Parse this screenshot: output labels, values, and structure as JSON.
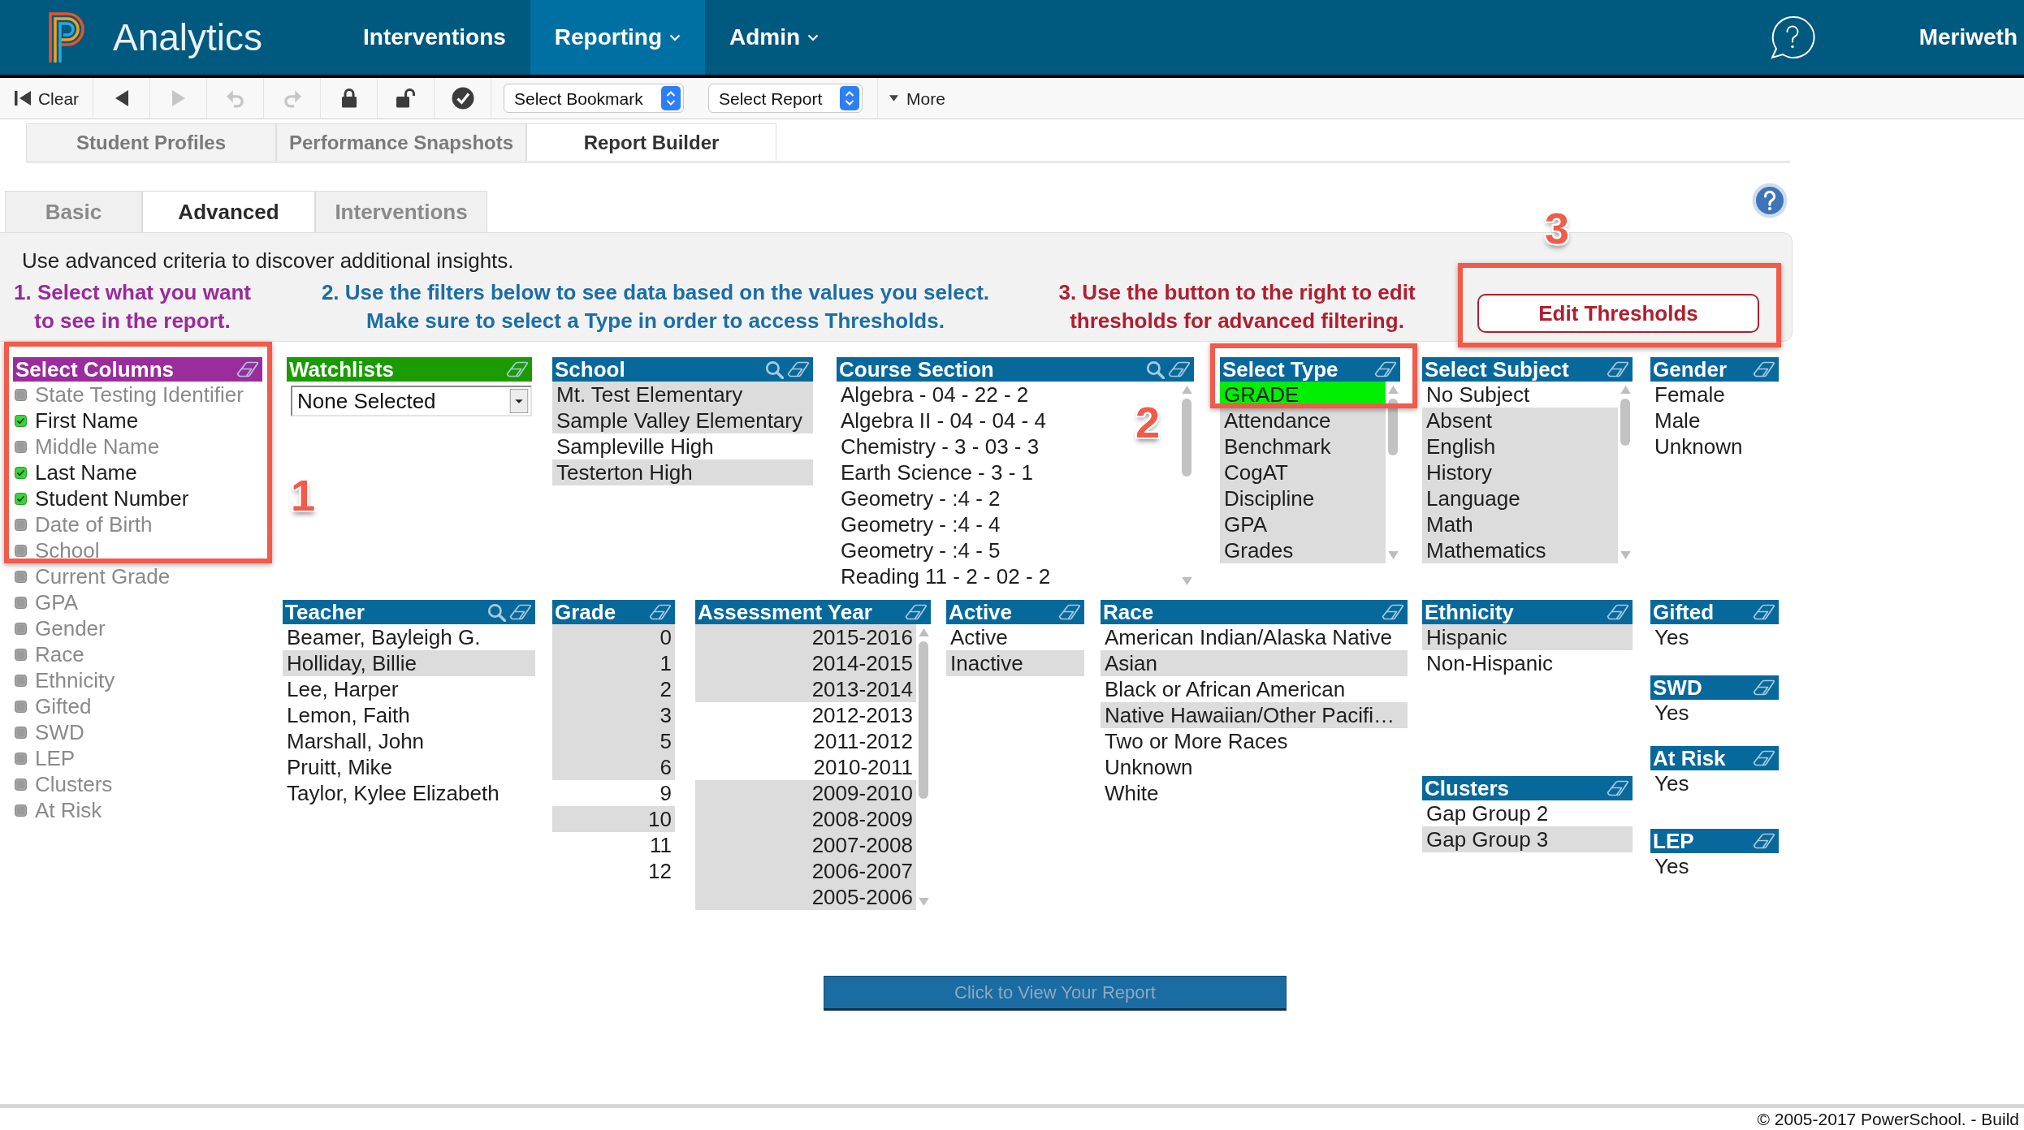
{
  "nav": {
    "brand": "Analytics",
    "items": [
      {
        "label": "Interventions",
        "selected": false,
        "menu": false
      },
      {
        "label": "Reporting",
        "selected": true,
        "menu": true
      },
      {
        "label": "Admin",
        "selected": false,
        "menu": true
      }
    ],
    "user": "Meriweth"
  },
  "toolbar": {
    "buttons": [
      {
        "kind": "first",
        "label": "Clear",
        "disabled": false
      },
      {
        "kind": "back",
        "disabled": false
      },
      {
        "kind": "forward",
        "disabled": true
      },
      {
        "kind": "undo",
        "disabled": true
      },
      {
        "kind": "redo",
        "disabled": true
      },
      {
        "kind": "lock",
        "disabled": false
      },
      {
        "kind": "unlock",
        "disabled": false
      },
      {
        "kind": "check",
        "disabled": false
      }
    ],
    "selects": [
      {
        "value": "Select Bookmark"
      },
      {
        "value": "Select Report"
      }
    ],
    "more": "More"
  },
  "page_tabs": [
    {
      "label": "Student Profiles",
      "selected": false
    },
    {
      "label": "Performance Snapshots",
      "selected": false
    },
    {
      "label": "Report Builder",
      "selected": true
    }
  ],
  "mode_tabs": [
    {
      "label": "Basic",
      "selected": false
    },
    {
      "label": "Advanced",
      "selected": true
    },
    {
      "label": "Interventions",
      "selected": false
    }
  ],
  "criteria_panel": {
    "intro": "Use advanced criteria to discover additional insights.",
    "steps": [
      {
        "lines": [
          "1. Select what you want",
          "to see in the report."
        ],
        "color": "#9b2a9b"
      },
      {
        "lines": [
          "2. Use the filters below to see data based on the values you select.",
          "Make sure to select a Type in order to access Thresholds."
        ],
        "color": "#1c6ea4"
      },
      {
        "lines": [
          "3. Use the button to the right to edit",
          "thresholds for advanced filtering."
        ],
        "color": "#b01e2f"
      }
    ],
    "edit_button": "Edit Thresholds"
  },
  "column_picker": {
    "title": "Select Columns",
    "color": "#9b2c9c",
    "items": [
      {
        "label": "State Testing Identifier",
        "checked": false
      },
      {
        "label": "First Name",
        "checked": true
      },
      {
        "label": "Middle Name",
        "checked": false
      },
      {
        "label": "Last Name",
        "checked": true
      },
      {
        "label": "Student Number",
        "checked": true
      },
      {
        "label": "Date of Birth",
        "checked": false
      },
      {
        "label": "School",
        "checked": false
      },
      {
        "label": "Current Grade",
        "checked": false
      },
      {
        "label": "GPA",
        "checked": false
      },
      {
        "label": "Gender",
        "checked": false
      },
      {
        "label": "Race",
        "checked": false
      },
      {
        "label": "Ethnicity",
        "checked": false
      },
      {
        "label": "Gifted",
        "checked": false
      },
      {
        "label": "SWD",
        "checked": false
      },
      {
        "label": "LEP",
        "checked": false
      },
      {
        "label": "Clusters",
        "checked": false
      },
      {
        "label": "At Risk",
        "checked": false
      }
    ]
  },
  "filter_row_1": [
    {
      "title": "Watchlists",
      "color": "#1a9b00",
      "kind": "dropdown",
      "value": "None Selected"
    },
    {
      "title": "School",
      "color": "#07699b",
      "kind": "list",
      "search": true,
      "items": [
        {
          "label": "Mt. Test Elementary",
          "selected": true
        },
        {
          "label": "Sample Valley Elementary",
          "selected": true
        },
        {
          "label": "Sampleville High",
          "selected": false
        },
        {
          "label": "Testerton High",
          "selected": true
        }
      ]
    },
    {
      "title": "Course Section",
      "color": "#07699b",
      "kind": "list",
      "search": true,
      "scrollbar": true,
      "items": [
        {
          "label": "Algebra - 04 - 22 - 2",
          "selected": false
        },
        {
          "label": "Algebra II - 04 - 04 - 4",
          "selected": false
        },
        {
          "label": "Chemistry - 3 - 03 - 3",
          "selected": false
        },
        {
          "label": "Earth Science - 3 - 1",
          "selected": false
        },
        {
          "label": "Geometry - :4 - 2",
          "selected": false
        },
        {
          "label": "Geometry - :4 - 4",
          "selected": false
        },
        {
          "label": "Geometry - :4 - 5",
          "selected": false
        },
        {
          "label": "Reading 11 - 2 - 02 - 2",
          "selected": false
        }
      ]
    },
    {
      "title": "Select Type",
      "color": "#07699b",
      "kind": "single",
      "scrollbar": true,
      "items": [
        {
          "label": "GRADE",
          "selected": true
        },
        {
          "label": "Attendance",
          "selected": false
        },
        {
          "label": "Benchmark",
          "selected": false
        },
        {
          "label": "CogAT",
          "selected": false
        },
        {
          "label": "Discipline",
          "selected": false
        },
        {
          "label": "GPA",
          "selected": false
        },
        {
          "label": "Grades",
          "selected": false
        }
      ]
    },
    {
      "title": "Select Subject",
      "color": "#07699b",
      "kind": "list",
      "scrollbar": true,
      "items": [
        {
          "label": "No Subject",
          "selected": false
        },
        {
          "label": "Absent",
          "selected": true
        },
        {
          "label": "English",
          "selected": true
        },
        {
          "label": "History",
          "selected": true
        },
        {
          "label": "Language",
          "selected": true
        },
        {
          "label": "Math",
          "selected": true
        },
        {
          "label": "Mathematics",
          "selected": true
        }
      ]
    },
    {
      "title": "Gender",
      "color": "#07699b",
      "kind": "list",
      "items": [
        {
          "label": "Female",
          "selected": false
        },
        {
          "label": "Male",
          "selected": false
        },
        {
          "label": "Unknown",
          "selected": false
        }
      ]
    }
  ],
  "filter_row_2": [
    {
      "panels": [
        {
          "title": "Teacher",
          "color": "#07699b",
          "kind": "list",
          "search": true,
          "items": [
            {
              "label": "Beamer, Bayleigh G.",
              "selected": false
            },
            {
              "label": "Holliday, Billie",
              "selected": true
            },
            {
              "label": "Lee, Harper",
              "selected": false
            },
            {
              "label": "Lemon, Faith",
              "selected": false
            },
            {
              "label": "Marshall, John",
              "selected": false
            },
            {
              "label": "Pruitt, Mike",
              "selected": false
            },
            {
              "label": "Taylor, Kylee Elizabeth",
              "selected": false
            }
          ]
        }
      ]
    },
    {
      "panels": [
        {
          "title": "Grade",
          "color": "#07699b",
          "kind": "numeric",
          "items": [
            {
              "label": "0",
              "selected": true
            },
            {
              "label": "1",
              "selected": true
            },
            {
              "label": "2",
              "selected": true
            },
            {
              "label": "3",
              "selected": true
            },
            {
              "label": "5",
              "selected": true
            },
            {
              "label": "6",
              "selected": true
            },
            {
              "label": "9",
              "selected": false
            },
            {
              "label": "10",
              "selected": true
            },
            {
              "label": "11",
              "selected": false
            },
            {
              "label": "12",
              "selected": false
            }
          ]
        }
      ]
    },
    {
      "panels": [
        {
          "title": "Assessment Year",
          "color": "#07699b",
          "kind": "numeric",
          "scrollbar": true,
          "items": [
            {
              "label": "2015-2016",
              "selected": true
            },
            {
              "label": "2014-2015",
              "selected": true
            },
            {
              "label": "2013-2014",
              "selected": true
            },
            {
              "label": "2012-2013",
              "selected": false
            },
            {
              "label": "2011-2012",
              "selected": false
            },
            {
              "label": "2010-2011",
              "selected": false
            },
            {
              "label": "2009-2010",
              "selected": true
            },
            {
              "label": "2008-2009",
              "selected": true
            },
            {
              "label": "2007-2008",
              "selected": true
            },
            {
              "label": "2006-2007",
              "selected": true
            },
            {
              "label": "2005-2006",
              "selected": true
            }
          ]
        }
      ]
    },
    {
      "panels": [
        {
          "title": "Active",
          "color": "#07699b",
          "kind": "list",
          "items": [
            {
              "label": "Active",
              "selected": false
            },
            {
              "label": "Inactive",
              "selected": true
            }
          ]
        }
      ]
    },
    {
      "panels": [
        {
          "title": "Race",
          "color": "#07699b",
          "kind": "list",
          "items": [
            {
              "label": "American Indian/Alaska Native",
              "selected": false
            },
            {
              "label": "Asian",
              "selected": true
            },
            {
              "label": "Black or African American",
              "selected": false
            },
            {
              "label": "Native Hawaiian/Other Pacifi…",
              "selected": true
            },
            {
              "label": "Two or More Races",
              "selected": false
            },
            {
              "label": "Unknown",
              "selected": false
            },
            {
              "label": "White",
              "selected": false
            }
          ]
        }
      ]
    },
    {
      "panels": [
        {
          "title": "Ethnicity",
          "color": "#07699b",
          "kind": "list",
          "items": [
            {
              "label": "Hispanic",
              "selected": true
            },
            {
              "label": "Non-Hispanic",
              "selected": false
            }
          ]
        },
        {
          "title": "Clusters",
          "color": "#07699b",
          "kind": "list",
          "items": [
            {
              "label": "Gap Group 2",
              "selected": false
            },
            {
              "label": "Gap Group 3",
              "selected": true
            }
          ]
        }
      ]
    },
    {
      "panels": [
        {
          "title": "Gifted",
          "color": "#07699b",
          "kind": "list",
          "items": [
            {
              "label": "Yes",
              "selected": false
            }
          ]
        },
        {
          "title": "SWD",
          "color": "#07699b",
          "kind": "list",
          "items": [
            {
              "label": "Yes",
              "selected": false
            }
          ]
        },
        {
          "title": "At Risk",
          "color": "#07699b",
          "kind": "list",
          "items": [
            {
              "label": "Yes",
              "selected": false
            }
          ]
        },
        {
          "title": "LEP",
          "color": "#07699b",
          "kind": "list",
          "items": [
            {
              "label": "Yes",
              "selected": false
            }
          ]
        }
      ]
    }
  ],
  "view_report_button": {
    "label": "Click to View Your Report",
    "disabled": true
  },
  "callouts": [
    {
      "label": "1"
    },
    {
      "label": "2"
    },
    {
      "label": "3"
    }
  ],
  "footer": "© 2005-2017 PowerSchool. - Build"
}
